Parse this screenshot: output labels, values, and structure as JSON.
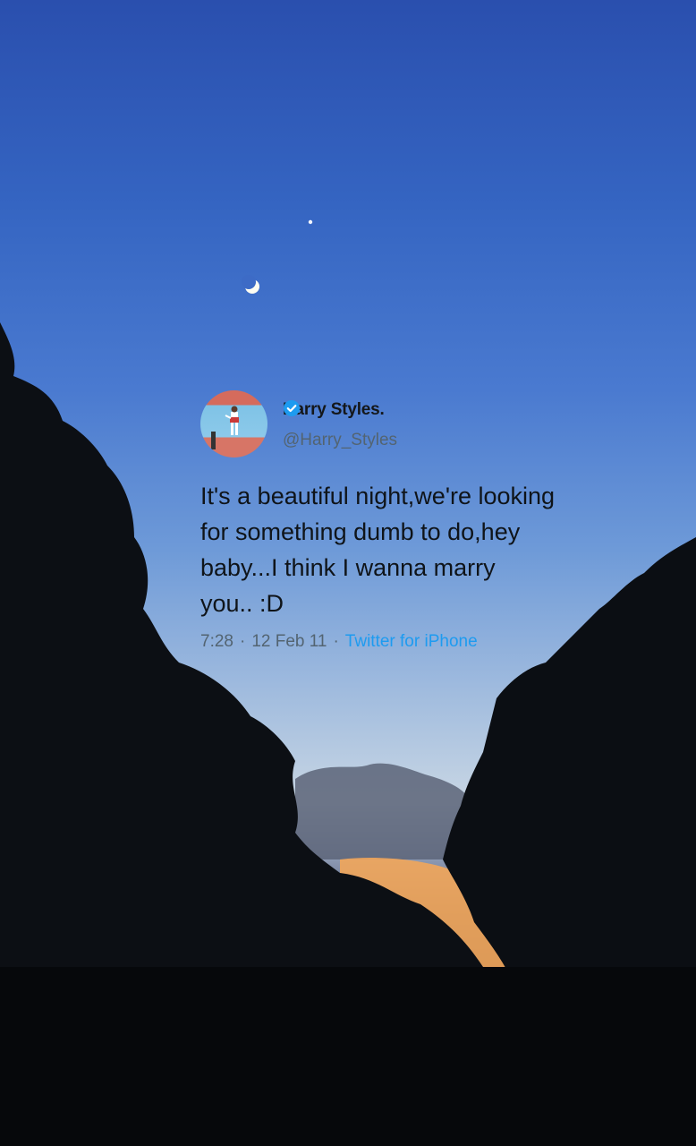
{
  "tweet": {
    "display_name": "Harry Styles.",
    "handle": "@Harry_Styles",
    "text": "It's a beautiful night,we're looking\nfor something dumb to do,hey\nbaby...I think I wanna marry\nyou.. :D",
    "time": "7:28",
    "separator": "·",
    "date": "12 Feb 11",
    "source": "Twitter for iPhone",
    "verified": true
  },
  "background": {
    "scene": "night-sky-with-crescent-moon-and-tree-silhouettes"
  }
}
